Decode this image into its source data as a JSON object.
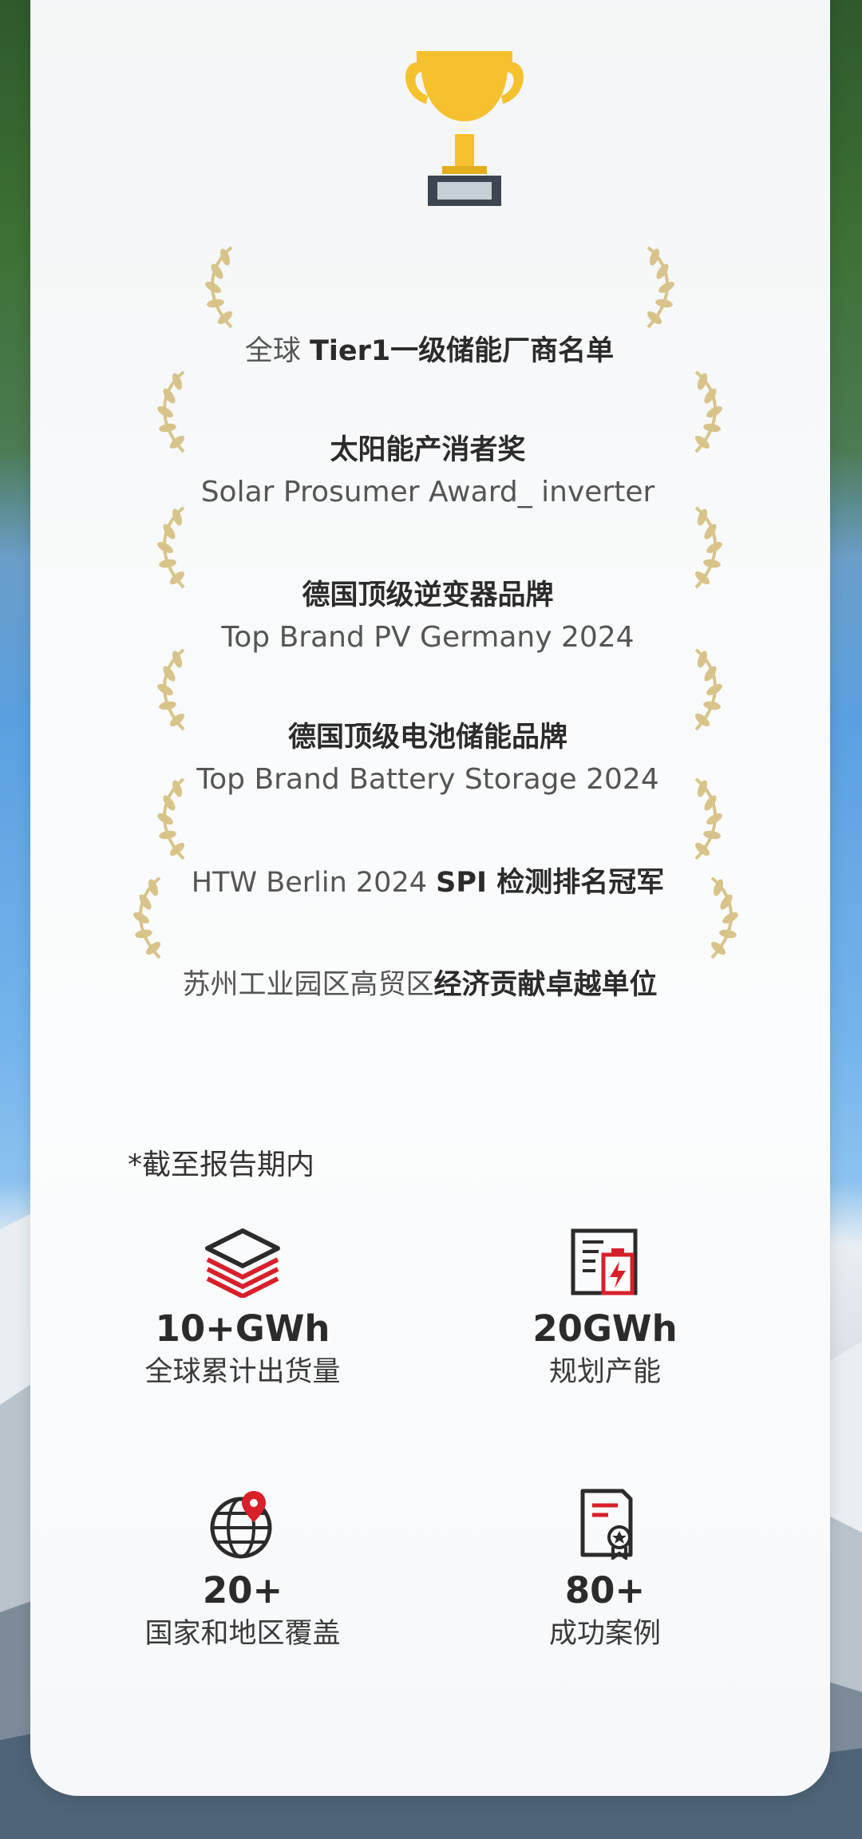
{
  "awards": [
    {
      "line1_pre": "全球 ",
      "line1_bold": "Tier1一级储能厂商名单",
      "line2": ""
    },
    {
      "line1_pre": "",
      "line1_bold": "太阳能产消者奖",
      "line2": "Solar Prosumer Award_ inverter"
    },
    {
      "line1_pre": "",
      "line1_bold": "德国顶级逆变器品牌",
      "line2": "Top Brand PV Germany 2024"
    },
    {
      "line1_pre": "",
      "line1_bold": "德国顶级电池储能品牌",
      "line2": "Top Brand Battery Storage 2024"
    },
    {
      "line1_pre": "HTW Berlin 2024 ",
      "line1_bold": "SPI 检测排名冠军",
      "line2": ""
    },
    {
      "line1_pre": "苏州工业园区高贸区",
      "line1_bold": "经济贡献卓越单位",
      "line2": ""
    }
  ],
  "note": "*截至报告期内",
  "stats": [
    {
      "value": "10+GWh",
      "label": "全球累计出货量",
      "icon": "layers-stack-icon"
    },
    {
      "value": "20GWh",
      "label": "规划产能",
      "icon": "factory-battery-icon"
    },
    {
      "value": "20+",
      "label": "国家和地区覆盖",
      "icon": "globe-pin-icon"
    },
    {
      "value": "80+",
      "label": "成功案例",
      "icon": "certificate-icon"
    }
  ],
  "colors": {
    "accent_red": "#d7202a",
    "trophy_gold": "#f6c12f",
    "laurel_gold": "#d8c48a"
  }
}
